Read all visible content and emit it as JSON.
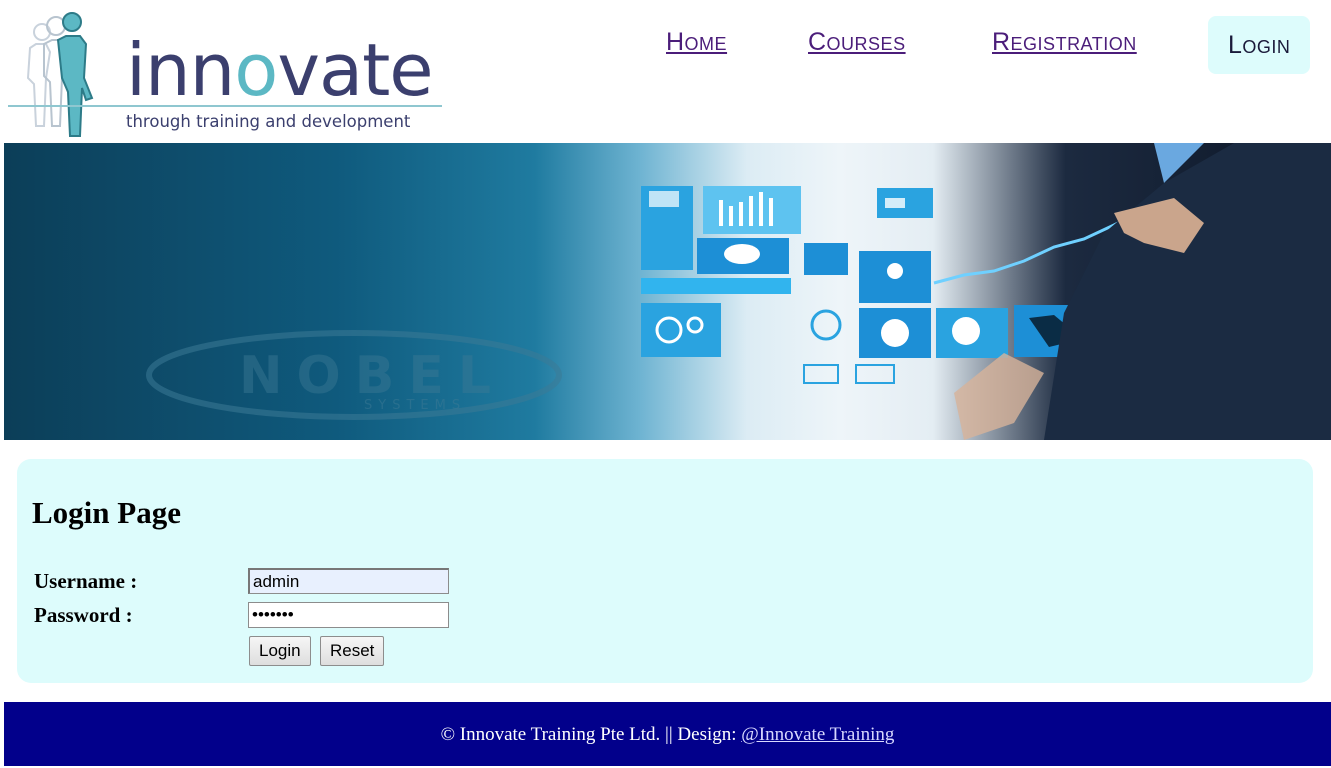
{
  "logo": {
    "name_prefix": "inn",
    "name_o": "o",
    "name_suffix": "vate",
    "tagline": "through training and development"
  },
  "nav": {
    "items": [
      {
        "label": "Home"
      },
      {
        "label": "Courses"
      },
      {
        "label": "Registration"
      },
      {
        "label": "Login"
      }
    ]
  },
  "banner": {
    "watermark_word": "NOBEL",
    "watermark_sub": "SYSTEMS"
  },
  "login": {
    "title": "Login Page",
    "username_label": "Username :",
    "username_value": "admin",
    "password_label": "Password :",
    "password_value": "•••••••",
    "login_button": "Login",
    "reset_button": "Reset"
  },
  "footer": {
    "text": "© Innovate Training Pte Ltd. || Design: ",
    "link": "@Innovate Training"
  },
  "colors": {
    "nav_link": "#4b1d7a",
    "active_tab_bg": "#ddfcfc",
    "panel_bg": "#ddfcfc",
    "footer_bg": "#02008b"
  }
}
